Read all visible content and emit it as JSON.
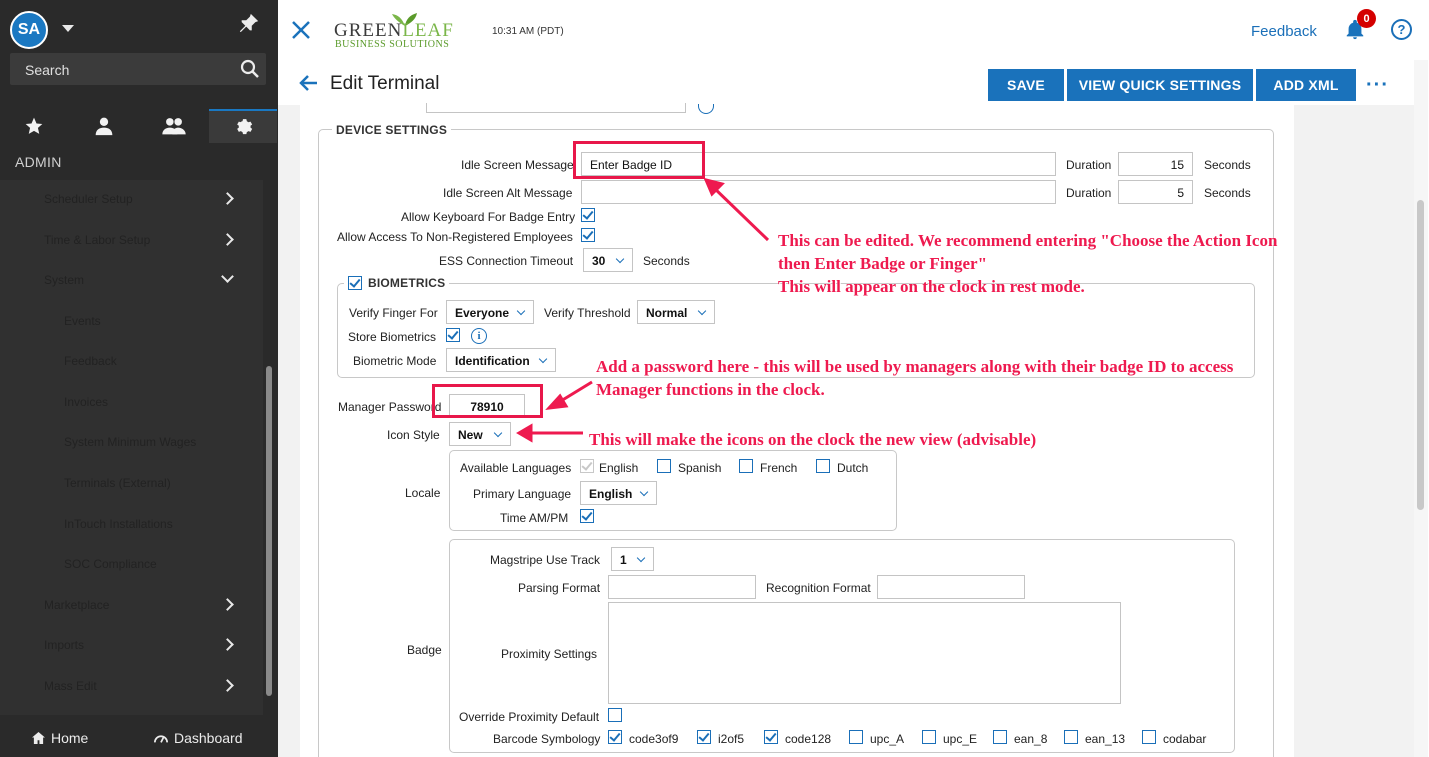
{
  "user": {
    "initials": "SA"
  },
  "sidebar": {
    "search_placeholder": "Search",
    "section_title": "ADMIN",
    "items": [
      {
        "label": "Scheduler Setup",
        "level": 1,
        "chevron": "right"
      },
      {
        "label": "Time & Labor Setup",
        "level": 1,
        "chevron": "right"
      },
      {
        "label": "System",
        "level": 1,
        "chevron": "down"
      },
      {
        "label": "Events",
        "level": 2
      },
      {
        "label": "Feedback",
        "level": 2
      },
      {
        "label": "Invoices",
        "level": 2
      },
      {
        "label": "System Minimum Wages",
        "level": 2
      },
      {
        "label": "Terminals (External)",
        "level": 2
      },
      {
        "label": "InTouch Installations",
        "level": 2
      },
      {
        "label": "SOC Compliance",
        "level": 2
      },
      {
        "label": "Marketplace",
        "level": 1,
        "chevron": "right"
      },
      {
        "label": "Imports",
        "level": 1,
        "chevron": "right"
      },
      {
        "label": "Mass Edit",
        "level": 1,
        "chevron": "right"
      }
    ],
    "footer": {
      "home": "Home",
      "dashboard": "Dashboard"
    }
  },
  "header": {
    "logo_green": "GREEN",
    "logo_leaf": "LEAF",
    "logo_sub": "BUSINESS SOLUTIONS",
    "time": "10:31 AM (PDT)",
    "feedback": "Feedback",
    "notifications": "0",
    "help": "?"
  },
  "page": {
    "title": "Edit Terminal",
    "buttons": {
      "save": "SAVE",
      "quick": "VIEW QUICK SETTINGS",
      "xml": "ADD XML",
      "more": "···"
    }
  },
  "device": {
    "legend": "DEVICE SETTINGS",
    "idle_msg_label": "Idle Screen Message",
    "idle_msg_value": "Enter Badge ID",
    "idle_alt_label": "Idle Screen Alt Message",
    "idle_alt_value": "",
    "duration_label": "Duration",
    "duration1": "15",
    "duration2": "5",
    "seconds": "Seconds",
    "kb_label": "Allow Keyboard For Badge Entry",
    "nonreg_label": "Allow Access To Non-Registered Employees",
    "ess_label": "ESS Connection Timeout",
    "ess_value": "30",
    "ess_seconds": "Seconds"
  },
  "bio": {
    "legend": "BIOMETRICS",
    "verify_for_label": "Verify Finger For",
    "verify_for_value": "Everyone",
    "threshold_label": "Verify Threshold",
    "threshold_value": "Normal",
    "store_label": "Store Biometrics",
    "mode_label": "Biometric Mode",
    "mode_value": "Identification"
  },
  "manager": {
    "label": "Manager Password",
    "value": "78910"
  },
  "icon_style": {
    "label": "Icon Style",
    "value": "New"
  },
  "locale": {
    "label": "Locale",
    "available_label": "Available Languages",
    "languages": [
      "English",
      "Spanish",
      "French",
      "Dutch"
    ],
    "primary_label": "Primary Language",
    "primary_value": "English",
    "ampm_label": "Time AM/PM"
  },
  "badge": {
    "label": "Badge",
    "magstripe_label": "Magstripe Use Track",
    "magstripe_value": "1",
    "parsing_label": "Parsing Format",
    "recognition_label": "Recognition Format",
    "proximity_label": "Proximity Settings",
    "override_label": "Override Proximity Default",
    "barcode_label": "Barcode Symbology",
    "barcodes": [
      "code3of9",
      "i2of5",
      "code128",
      "upc_A",
      "upc_E",
      "ean_8",
      "ean_13",
      "codabar"
    ]
  },
  "annotations": {
    "idle_note_1": "This can be edited. We recommend entering \"Choose the Action Icon",
    "idle_note_2": "then Enter Badge or Finger\"",
    "idle_note_3": "This will appear on the clock in rest mode.",
    "pw_note_1": "Add a password here - this will be used by managers along with their badge ID to access",
    "pw_note_2": "Manager functions in the clock.",
    "icon_note": "This will make the icons on the clock the new view (advisable)"
  },
  "colors": {
    "accent": "#1a72bb",
    "annotation": "#ee1a4f",
    "sidebar": "#2a2a2a"
  }
}
